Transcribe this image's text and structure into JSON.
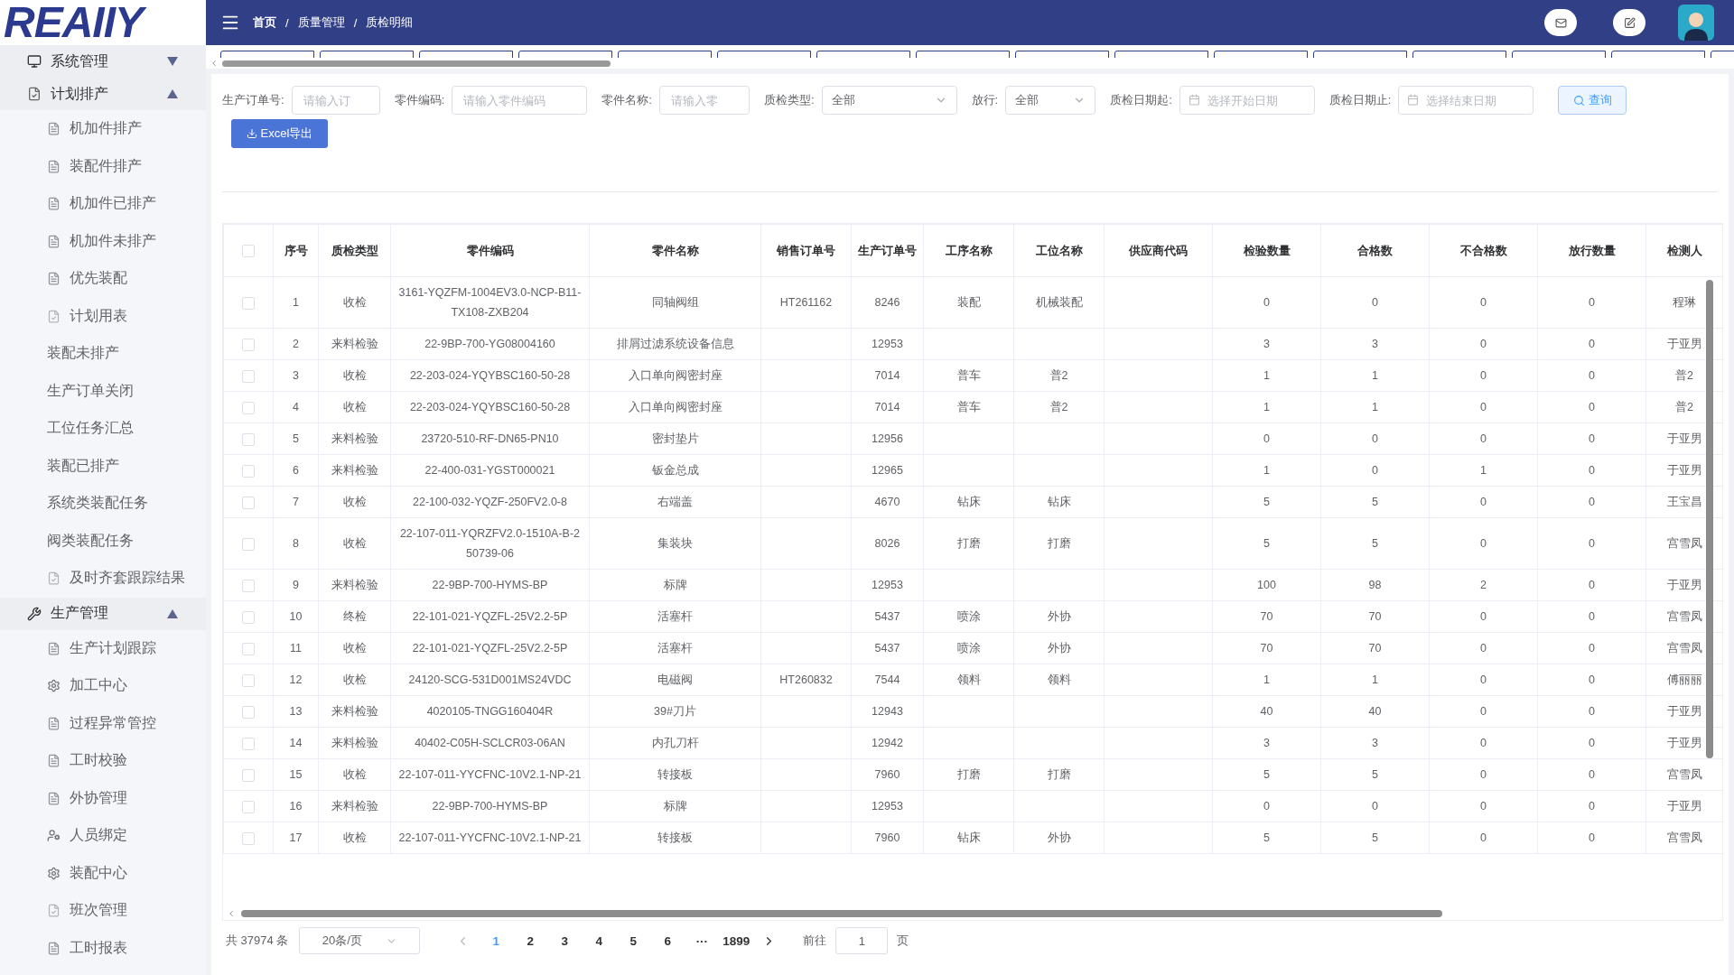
{
  "logo": {
    "text": "REAIIY"
  },
  "breadcrumb": [
    "首页",
    "质量管理",
    "质检明细"
  ],
  "breadcrumb_separator": "/",
  "sidebar": [
    {
      "label": "系统管理",
      "expanded": false
    },
    {
      "label": "计划排产",
      "expanded": true,
      "children": [
        {
          "label": "机加件排产",
          "kind": "doc"
        },
        {
          "label": "装配件排产",
          "kind": "doc"
        },
        {
          "label": "机加件已排产",
          "kind": "doc"
        },
        {
          "label": "机加件未排产",
          "kind": "doc"
        },
        {
          "label": "优先装配",
          "kind": "doc"
        },
        {
          "label": "计划用表",
          "kind": "check"
        },
        {
          "label": "装配未排产",
          "kind": "plain"
        },
        {
          "label": "生产订单关闭",
          "kind": "plain"
        },
        {
          "label": "工位任务汇总",
          "kind": "plain"
        },
        {
          "label": "装配已排产",
          "kind": "plain"
        },
        {
          "label": "系统类装配任务",
          "kind": "plain"
        },
        {
          "label": "阀类装配任务",
          "kind": "plain"
        },
        {
          "label": "及时齐套跟踪结果",
          "kind": "check"
        }
      ]
    },
    {
      "label": "生产管理",
      "expanded": true,
      "children": [
        {
          "label": "生产计划跟踪",
          "kind": "doc"
        },
        {
          "label": "加工中心",
          "kind": "gear"
        },
        {
          "label": "过程异常管控",
          "kind": "doc"
        },
        {
          "label": "工时校验",
          "kind": "doc"
        },
        {
          "label": "外协管理",
          "kind": "doc"
        },
        {
          "label": "人员绑定",
          "kind": "user"
        },
        {
          "label": "装配中心",
          "kind": "gear"
        },
        {
          "label": "班次管理",
          "kind": "check"
        },
        {
          "label": "工时报表",
          "kind": "doc"
        }
      ]
    }
  ],
  "filters": [
    {
      "label": "生产订单号:",
      "kind": "input",
      "placeholder": "请输入订"
    },
    {
      "label": "零件编码:",
      "kind": "input",
      "placeholder": "请输入零件编码"
    },
    {
      "label": "零件名称:",
      "kind": "input",
      "placeholder": "请输入零"
    },
    {
      "label": "质检类型:",
      "kind": "select",
      "value": "全部"
    },
    {
      "label": "放行:",
      "kind": "select",
      "value": "全部"
    },
    {
      "label": "质检日期起:",
      "kind": "date",
      "placeholder": "选择开始日期"
    },
    {
      "label": "质检日期止:",
      "kind": "date",
      "placeholder": "选择结束日期"
    }
  ],
  "query_button": "查询",
  "export_button": "Excel导出",
  "table": {
    "all_checked": false,
    "columns": [
      "序号",
      "质检类型",
      "零件编码",
      "零件名称",
      "销售订单号",
      "生产订单号",
      "工序名称",
      "工位名称",
      "供应商代码",
      "检验数量",
      "合格数",
      "不合格数",
      "放行数量",
      "检测人"
    ],
    "rows": [
      {
        "checked": false,
        "cells": [
          "1",
          "收检",
          "3161-YQZFM-1004EV3.0-NCP-B11-TX108-ZXB204",
          "同轴阀组",
          "HT261162",
          "8246",
          "装配",
          "机械装配",
          "",
          "0",
          "0",
          "0",
          "0",
          "程琳"
        ]
      },
      {
        "checked": false,
        "cells": [
          "2",
          "来料检验",
          "22-9BP-700-YG08004160",
          "排屑过滤系统设备信息",
          "",
          "12953",
          "",
          "",
          "",
          "3",
          "3",
          "0",
          "0",
          "于亚男"
        ]
      },
      {
        "checked": false,
        "cells": [
          "3",
          "收检",
          "22-203-024-YQYBSC160-50-28",
          "入口单向阀密封座",
          "",
          "7014",
          "普车",
          "普2",
          "",
          "1",
          "1",
          "0",
          "0",
          "普2"
        ]
      },
      {
        "checked": false,
        "cells": [
          "4",
          "收检",
          "22-203-024-YQYBSC160-50-28",
          "入口单向阀密封座",
          "",
          "7014",
          "普车",
          "普2",
          "",
          "1",
          "1",
          "0",
          "0",
          "普2"
        ]
      },
      {
        "checked": false,
        "cells": [
          "5",
          "来料检验",
          "23720-510-RF-DN65-PN10",
          "密封垫片",
          "",
          "12956",
          "",
          "",
          "",
          "0",
          "0",
          "0",
          "0",
          "于亚男"
        ]
      },
      {
        "checked": false,
        "cells": [
          "6",
          "来料检验",
          "22-400-031-YGST000021",
          "钣金总成",
          "",
          "12965",
          "",
          "",
          "",
          "1",
          "0",
          "1",
          "0",
          "于亚男"
        ]
      },
      {
        "checked": false,
        "cells": [
          "7",
          "收检",
          "22-100-032-YQZF-250FV2.0-8",
          "右端盖",
          "",
          "4670",
          "钻床",
          "钻床",
          "",
          "5",
          "5",
          "0",
          "0",
          "王宝昌"
        ]
      },
      {
        "checked": false,
        "cells": [
          "8",
          "收检",
          "22-107-011-YQRZFV2.0-1510A-B-250739-06",
          "集装块",
          "",
          "8026",
          "打磨",
          "打磨",
          "",
          "5",
          "5",
          "0",
          "0",
          "宫雪凤"
        ]
      },
      {
        "checked": false,
        "cells": [
          "9",
          "来料检验",
          "22-9BP-700-HYMS-BP",
          "标牌",
          "",
          "12953",
          "",
          "",
          "",
          "100",
          "98",
          "2",
          "0",
          "于亚男"
        ]
      },
      {
        "checked": false,
        "cells": [
          "10",
          "终检",
          "22-101-021-YQZFL-25V2.2-5P",
          "活塞杆",
          "",
          "5437",
          "喷涂",
          "外协",
          "",
          "70",
          "70",
          "0",
          "0",
          "宫雪凤"
        ]
      },
      {
        "checked": false,
        "cells": [
          "11",
          "收检",
          "22-101-021-YQZFL-25V2.2-5P",
          "活塞杆",
          "",
          "5437",
          "喷涂",
          "外协",
          "",
          "70",
          "70",
          "0",
          "0",
          "宫雪凤"
        ]
      },
      {
        "checked": false,
        "cells": [
          "12",
          "收检",
          "24120-SCG-531D001MS24VDC",
          "电磁阀",
          "HT260832",
          "7544",
          "领料",
          "领料",
          "",
          "1",
          "1",
          "0",
          "0",
          "傅丽丽"
        ]
      },
      {
        "checked": false,
        "cells": [
          "13",
          "来料检验",
          "4020105-TNGG160404R",
          "39#刀片",
          "",
          "12943",
          "",
          "",
          "",
          "40",
          "40",
          "0",
          "0",
          "于亚男"
        ]
      },
      {
        "checked": false,
        "cells": [
          "14",
          "来料检验",
          "40402-C05H-SCLCR03-06AN",
          "内孔刀杆",
          "",
          "12942",
          "",
          "",
          "",
          "3",
          "3",
          "0",
          "0",
          "于亚男"
        ]
      },
      {
        "checked": false,
        "cells": [
          "15",
          "收检",
          "22-107-011-YYCFNC-10V2.1-NP-21",
          "转接板",
          "",
          "7960",
          "打磨",
          "打磨",
          "",
          "5",
          "5",
          "0",
          "0",
          "宫雪凤"
        ]
      },
      {
        "checked": false,
        "cells": [
          "16",
          "来料检验",
          "22-9BP-700-HYMS-BP",
          "标牌",
          "",
          "12953",
          "",
          "",
          "",
          "0",
          "0",
          "0",
          "0",
          "于亚男"
        ]
      },
      {
        "checked": false,
        "cells": [
          "17",
          "收检",
          "22-107-011-YYCFNC-10V2.1-NP-21",
          "转接板",
          "",
          "7960",
          "钻床",
          "外协",
          "",
          "5",
          "5",
          "0",
          "0",
          "宫雪凤"
        ]
      }
    ]
  },
  "pagination": {
    "total": "共 37974 条",
    "page_size": "20条/页",
    "pages": [
      {
        "label": "1",
        "selected": true
      },
      {
        "label": "2",
        "selected": false
      },
      {
        "label": "3",
        "selected": false
      },
      {
        "label": "4",
        "selected": false
      },
      {
        "label": "5",
        "selected": false
      },
      {
        "label": "6",
        "selected": false
      },
      {
        "label": "···",
        "selected": false
      },
      {
        "label": "1899",
        "selected": false
      }
    ],
    "goto_label": "前往",
    "goto_value": "1",
    "goto_suffix": "页"
  }
}
